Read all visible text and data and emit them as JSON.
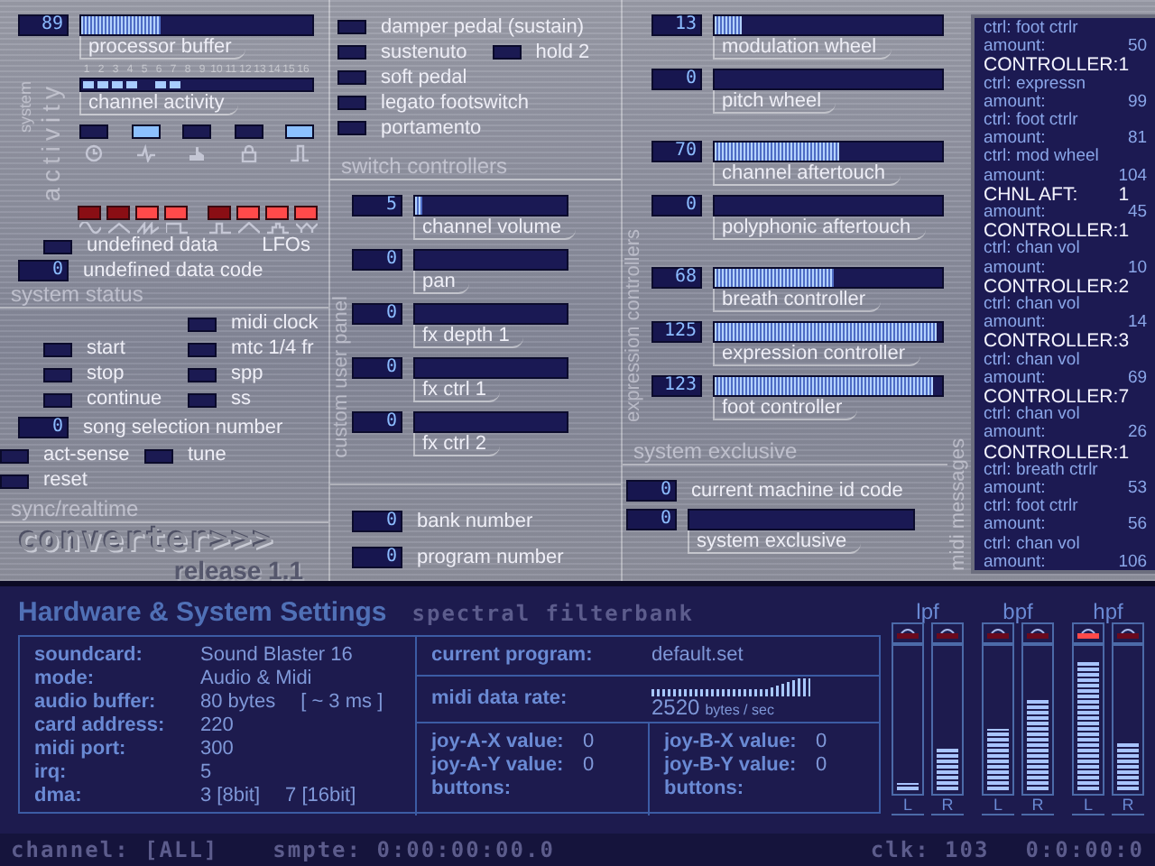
{
  "activity": {
    "label_small": "system",
    "label_large": "activity",
    "processor_buffer": {
      "display": "89",
      "label": "processor buffer",
      "level": 0.34
    },
    "channel_activity": {
      "label": "channel activity",
      "channels": [
        {
          "number": "1",
          "on": true
        },
        {
          "number": "2",
          "on": true
        },
        {
          "number": "3",
          "on": true
        },
        {
          "number": "4",
          "on": true
        },
        {
          "number": "5",
          "on": false
        },
        {
          "number": "6",
          "on": true
        },
        {
          "number": "7",
          "on": true
        },
        {
          "number": "8",
          "on": false
        },
        {
          "number": "9",
          "on": false
        },
        {
          "number": "10",
          "on": false
        },
        {
          "number": "11",
          "on": false
        },
        {
          "number": "12",
          "on": false
        },
        {
          "number": "13",
          "on": false
        },
        {
          "number": "14",
          "on": false
        },
        {
          "number": "15",
          "on": false
        },
        {
          "number": "16",
          "on": false
        }
      ]
    },
    "lights": [
      {
        "kind": "clock",
        "on": false
      },
      {
        "kind": "wave",
        "on": true
      },
      {
        "kind": "hand",
        "on": false
      },
      {
        "kind": "lock",
        "on": false
      },
      {
        "kind": "pulse",
        "on": true
      }
    ],
    "lfos": {
      "label": "LFOs",
      "items": [
        {
          "kind": "sine",
          "on": false
        },
        {
          "kind": "triangle",
          "on": false
        },
        {
          "kind": "saw",
          "on": true
        },
        {
          "kind": "square",
          "on": true
        },
        {
          "kind": "pulse",
          "on": false
        },
        {
          "kind": "peak",
          "on": true
        },
        {
          "kind": "step",
          "on": true
        },
        {
          "kind": "random",
          "on": true
        }
      ]
    }
  },
  "system_status": {
    "label": "system status",
    "undefined_data": {
      "label": "undefined data",
      "on": false
    },
    "undefined_data_code": {
      "display": "0",
      "label": "undefined data code"
    }
  },
  "sync": {
    "label": "sync/realtime",
    "left_lights": [
      {
        "label": "start",
        "on": false
      },
      {
        "label": "stop",
        "on": false
      },
      {
        "label": "continue",
        "on": false
      }
    ],
    "right_lights": [
      {
        "label": "midi clock",
        "on": false
      },
      {
        "label": "mtc 1/4 fr",
        "on": false
      },
      {
        "label": "spp",
        "on": false
      },
      {
        "label": "ss",
        "on": false
      }
    ],
    "song_selection": {
      "display": "0",
      "label": "song selection number"
    },
    "sense_lights": [
      {
        "label": "act-sense",
        "on": false
      },
      {
        "label": "tune",
        "on": false
      },
      {
        "label": "reset",
        "on": false
      }
    ]
  },
  "logo": {
    "name": "converter>>>",
    "release": "release 1.1"
  },
  "switches": {
    "label": "switch controllers",
    "rows": [
      [
        {
          "label": "damper pedal (sustain)",
          "on": false
        }
      ],
      [
        {
          "label": "sustenuto",
          "on": false
        },
        {
          "label": "hold 2",
          "on": false
        }
      ],
      [
        {
          "label": "soft pedal",
          "on": false
        }
      ],
      [
        {
          "label": "legato footswitch",
          "on": false
        }
      ],
      [
        {
          "label": "portamento",
          "on": false
        }
      ]
    ]
  },
  "user_panel": {
    "label": "custom user panel",
    "controllers": [
      {
        "display": "5",
        "label": "channel volume",
        "level": 0.05
      },
      {
        "display": "0",
        "label": "pan"
      },
      {
        "display": "0",
        "label": "fx depth 1"
      },
      {
        "display": "0",
        "label": "fx ctrl 1"
      },
      {
        "display": "0",
        "label": "fx ctrl 2"
      }
    ],
    "bank": {
      "display": "0",
      "label": "bank number"
    },
    "program": {
      "display": "0",
      "label": "program number"
    }
  },
  "expression": {
    "label": "expression controllers",
    "groups": [
      [
        {
          "display": "13",
          "label": "modulation wheel",
          "level": 0.12
        },
        {
          "display": "0",
          "label": "pitch wheel"
        }
      ],
      [
        {
          "display": "70",
          "label": "channel aftertouch",
          "level": 0.55
        },
        {
          "display": "0",
          "label": "polyphonic aftertouch"
        }
      ],
      [
        {
          "display": "68",
          "label": "breath controller",
          "level": 0.52
        },
        {
          "display": "125",
          "label": "expression controller",
          "level": 0.98
        },
        {
          "display": "123",
          "label": "foot controller",
          "level": 0.96
        }
      ]
    ]
  },
  "sysex": {
    "label": "system exclusive",
    "machine_id": {
      "display": "0",
      "label": "current machine id code"
    },
    "data": {
      "display": "0",
      "label": "system exclusive"
    }
  },
  "midi_messages": {
    "label": "midi messages",
    "lines": [
      {
        "kind": "ctrl",
        "text": "ctrl: foot ctrlr"
      },
      {
        "kind": "amount",
        "text": "amount:",
        "value": "50"
      },
      {
        "kind": "event",
        "text": "CONTROLLER:",
        "value": "1"
      },
      {
        "kind": "ctrl",
        "text": "ctrl: expressn"
      },
      {
        "kind": "amount",
        "text": "amount:",
        "value": "99"
      },
      {
        "kind": "ctrl",
        "text": "ctrl: foot ctrlr"
      },
      {
        "kind": "amount",
        "text": "amount:",
        "value": "81"
      },
      {
        "kind": "ctrl",
        "text": "ctrl: mod wheel"
      },
      {
        "kind": "amount",
        "text": "amount:",
        "value": "104"
      },
      {
        "kind": "event",
        "text": "CHNL AFT:",
        "value": "1"
      },
      {
        "kind": "amount",
        "text": "amount:",
        "value": "45"
      },
      {
        "kind": "event",
        "text": "CONTROLLER:",
        "value": "1"
      },
      {
        "kind": "ctrl",
        "text": "ctrl: chan vol"
      },
      {
        "kind": "amount",
        "text": "amount:",
        "value": "10"
      },
      {
        "kind": "event",
        "text": "CONTROLLER:",
        "value": "2"
      },
      {
        "kind": "ctrl",
        "text": "ctrl: chan vol"
      },
      {
        "kind": "amount",
        "text": "amount:",
        "value": "14"
      },
      {
        "kind": "event",
        "text": "CONTROLLER:",
        "value": "3"
      },
      {
        "kind": "ctrl",
        "text": "ctrl: chan vol"
      },
      {
        "kind": "amount",
        "text": "amount:",
        "value": "69"
      },
      {
        "kind": "event",
        "text": "CONTROLLER:",
        "value": "7"
      },
      {
        "kind": "ctrl",
        "text": "ctrl: chan vol"
      },
      {
        "kind": "amount",
        "text": "amount:",
        "value": "26"
      },
      {
        "kind": "event",
        "text": "CONTROLLER:",
        "value": "1"
      },
      {
        "kind": "ctrl",
        "text": "ctrl: breath ctrlr"
      },
      {
        "kind": "amount",
        "text": "amount:",
        "value": "53"
      },
      {
        "kind": "ctrl",
        "text": "ctrl: foot ctrlr"
      },
      {
        "kind": "amount",
        "text": "amount:",
        "value": "56"
      },
      {
        "kind": "ctrl",
        "text": "ctrl: chan vol"
      },
      {
        "kind": "amount",
        "text": "amount:",
        "value": "106"
      }
    ]
  },
  "hardware": {
    "title": "Hardware & System Settings",
    "subtitle": "spectral filterbank",
    "settings": [
      {
        "label": "soundcard:",
        "values": [
          "Sound Blaster 16"
        ]
      },
      {
        "label": "mode:",
        "values": [
          "Audio & Midi"
        ]
      },
      {
        "label": "audio buffer:",
        "values": [
          "80 bytes",
          "[ ~ 3 ms ]"
        ]
      },
      {
        "label": "card address:",
        "values": [
          "220"
        ]
      },
      {
        "label": "midi port:",
        "values": [
          "300"
        ]
      },
      {
        "label": "irq:",
        "values": [
          "5"
        ]
      },
      {
        "label": "dma:",
        "values": [
          "3 [8bit]",
          "7 [16bit]"
        ]
      }
    ],
    "current_program": {
      "label": "current program:",
      "value": "default.set"
    },
    "midi_rate": {
      "label": "midi data rate:",
      "value": "2520",
      "unit": "bytes / sec"
    },
    "joy_a": [
      {
        "label": "joy-A-X value:",
        "value": "0"
      },
      {
        "label": "joy-A-Y value:",
        "value": "0"
      },
      {
        "label": "buttons:"
      }
    ],
    "joy_b": [
      {
        "label": "joy-B-X value:",
        "value": "0"
      },
      {
        "label": "joy-B-Y value:",
        "value": "0"
      },
      {
        "label": "buttons:"
      }
    ]
  },
  "filters": [
    {
      "name": "lpf",
      "channels": [
        {
          "label": "L",
          "level": 0.05,
          "clip": false
        },
        {
          "label": "R",
          "level": 0.3,
          "clip": false
        }
      ]
    },
    {
      "name": "bpf",
      "channels": [
        {
          "label": "L",
          "level": 0.43,
          "clip": false
        },
        {
          "label": "R",
          "level": 0.65,
          "clip": false
        }
      ]
    },
    {
      "name": "hpf",
      "channels": [
        {
          "label": "L",
          "level": 0.92,
          "clip": true
        },
        {
          "label": "R",
          "level": 0.33,
          "clip": false
        }
      ]
    }
  ],
  "status_bar": {
    "channel": "channel: [ALL]",
    "smpte": "smpte: 0:00:00:00.0",
    "clock": "clk: 103",
    "time": "0:0:00:0"
  }
}
